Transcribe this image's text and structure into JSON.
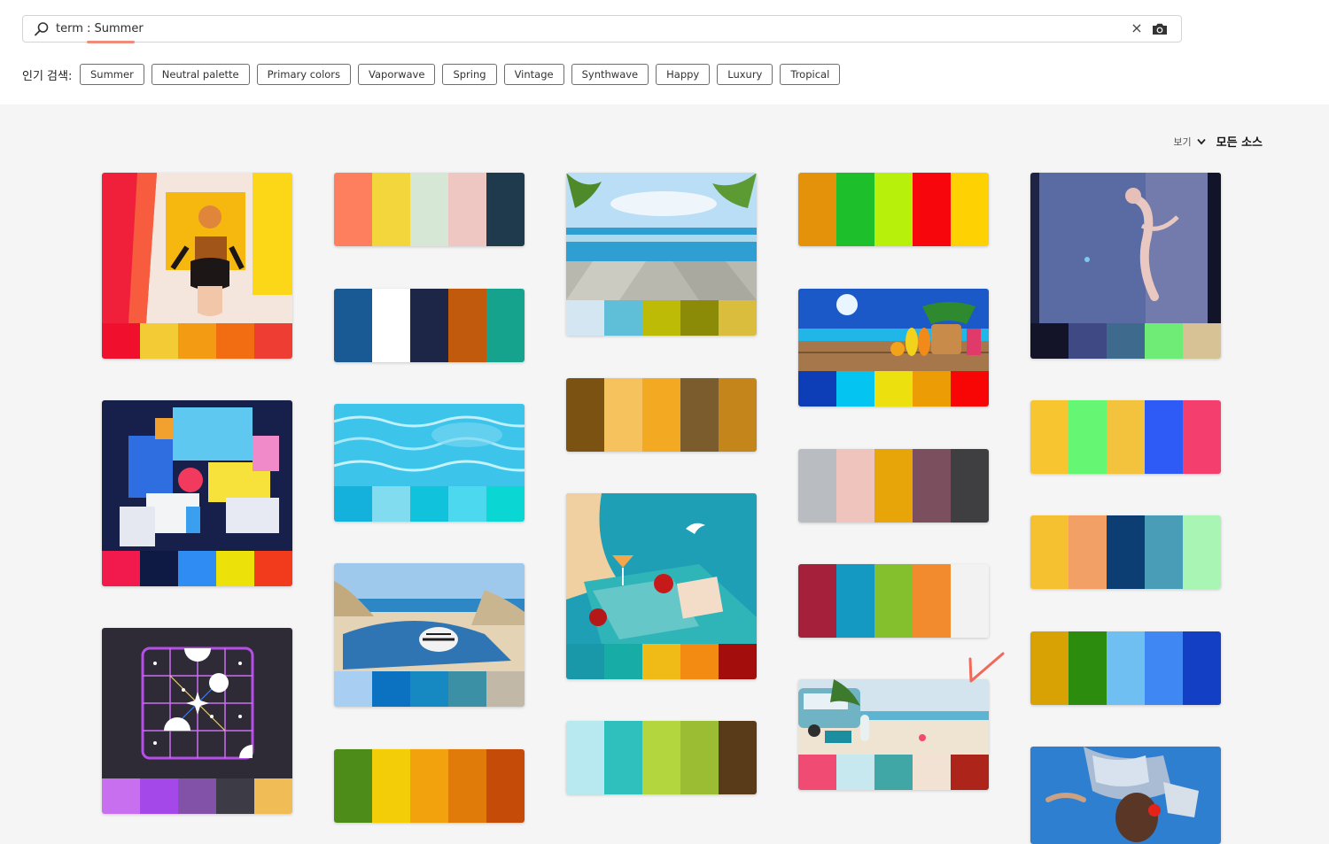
{
  "search": {
    "prefix": "term : ",
    "value": "Summer",
    "clear_label": "×"
  },
  "popular": {
    "label": "인기 검색:",
    "chips": [
      "Summer",
      "Neutral palette",
      "Primary colors",
      "Vaporwave",
      "Spring",
      "Vintage",
      "Synthwave",
      "Happy",
      "Luxury",
      "Tropical"
    ]
  },
  "view": {
    "view_label": "보기",
    "source_label": "모든 소스"
  },
  "colors": {
    "accent": "#f08a7a",
    "check_mark": "#f06a5a"
  },
  "cards": {
    "c1": {
      "kind": "image",
      "subject": "woman-yellow-frame",
      "swatches": [
        "#f0102e",
        "#f2cb35",
        "#f29b13",
        "#f26d12",
        "#ee3d32"
      ]
    },
    "c2": {
      "kind": "palette",
      "swatches": [
        "#fe7f5e",
        "#f2d63b",
        "#d6e7d5",
        "#eec7c3",
        "#1f3a4d"
      ]
    },
    "c3": {
      "kind": "image",
      "subject": "beach-deck-palms",
      "swatches": [
        "#d4e6f2",
        "#5fbfd9",
        "#bdbb06",
        "#8c8b08",
        "#dbbd3e"
      ]
    },
    "c4": {
      "kind": "palette",
      "swatches": [
        "#e5920b",
        "#1dbf2a",
        "#b7f00a",
        "#f7070c",
        "#fdd102"
      ]
    },
    "c5": {
      "kind": "image",
      "subject": "figure-glass-abstract",
      "swatches": [
        "#131427",
        "#3f4a85",
        "#3d6a8d",
        "#6fec75",
        "#d7c295"
      ]
    },
    "c6": {
      "kind": "palette",
      "swatches": [
        "#1a5a94",
        "#ffffff",
        "#1e2648",
        "#c25a0d",
        "#16a38e"
      ]
    },
    "c7": {
      "kind": "palette",
      "swatches": [
        "#7b5211",
        "#f6c25e",
        "#f3aa22",
        "#7b5c2d",
        "#c4861a"
      ]
    },
    "c8": {
      "kind": "image",
      "subject": "beach-flipflops",
      "swatches": [
        "#0d3eb8",
        "#04c4f2",
        "#ece00e",
        "#ec9c05",
        "#f80505"
      ]
    },
    "c9": {
      "kind": "palette",
      "swatches": [
        "#f6c52f",
        "#65f673",
        "#f4c33e",
        "#2e5bf6",
        "#f43f6e"
      ]
    },
    "c10": {
      "kind": "image",
      "subject": "isometric-city-illustration",
      "swatches": [
        "#f21a4c",
        "#0f1a44",
        "#2e8cf2",
        "#ede10a",
        "#f23a1c"
      ]
    },
    "c11": {
      "kind": "image",
      "subject": "pool-water",
      "swatches": [
        "#14b1dc",
        "#82dcef",
        "#10c2db",
        "#4cd9ef",
        "#0ad6d3"
      ]
    },
    "c12": {
      "kind": "palette",
      "swatches": [
        "#b9bcc1",
        "#efc4bd",
        "#e8a50a",
        "#7c4f5e",
        "#3f3e41"
      ]
    },
    "c13": {
      "kind": "palette",
      "swatches": [
        "#f5c130",
        "#f2a066",
        "#0c3e74",
        "#4a9db6",
        "#a9f5b3"
      ]
    },
    "c14": {
      "kind": "image",
      "subject": "cocktail-picnic-illustration",
      "swatches": [
        "#1898a9",
        "#18aca6",
        "#f1bb17",
        "#f38a12",
        "#a30e0d"
      ]
    },
    "c15": {
      "kind": "palette",
      "swatches": [
        "#a5213b",
        "#149ac2",
        "#84c02e",
        "#f28a2e",
        "#f2f2f2"
      ]
    },
    "c16": {
      "kind": "image",
      "subject": "beach-towel-hat",
      "swatches": [
        "#a8cef1",
        "#0a72c1",
        "#1689c3",
        "#3c90a6",
        "#c2b8a8"
      ]
    },
    "c17": {
      "kind": "palette",
      "swatches": [
        "#d8a204",
        "#2c8c0d",
        "#70bff2",
        "#3f87f2",
        "#123fc4"
      ]
    },
    "c18": {
      "kind": "image",
      "subject": "dark-grid-icon",
      "swatches": [
        "#c86ff0",
        "#a448ea",
        "#8252a8",
        "#3d3b45",
        "#f0bc55"
      ]
    },
    "c19": {
      "kind": "image",
      "subject": "vintage-van-beach",
      "swatches": [
        "#f04b73",
        "#c7e8ef",
        "#40a6a6",
        "#f1e2d4",
        "#ad251a"
      ]
    },
    "c20": {
      "kind": "palette",
      "swatches": [
        "#4e8c1a",
        "#f2cd08",
        "#f2a20c",
        "#e07a08",
        "#c44c08"
      ]
    },
    "c21": {
      "kind": "palette",
      "swatches": [
        "#b9e9f0",
        "#2fbfbd",
        "#b3d63f",
        "#9bbd34",
        "#593a19"
      ]
    },
    "c22": {
      "kind": "image",
      "subject": "fashion-sky"
    }
  }
}
